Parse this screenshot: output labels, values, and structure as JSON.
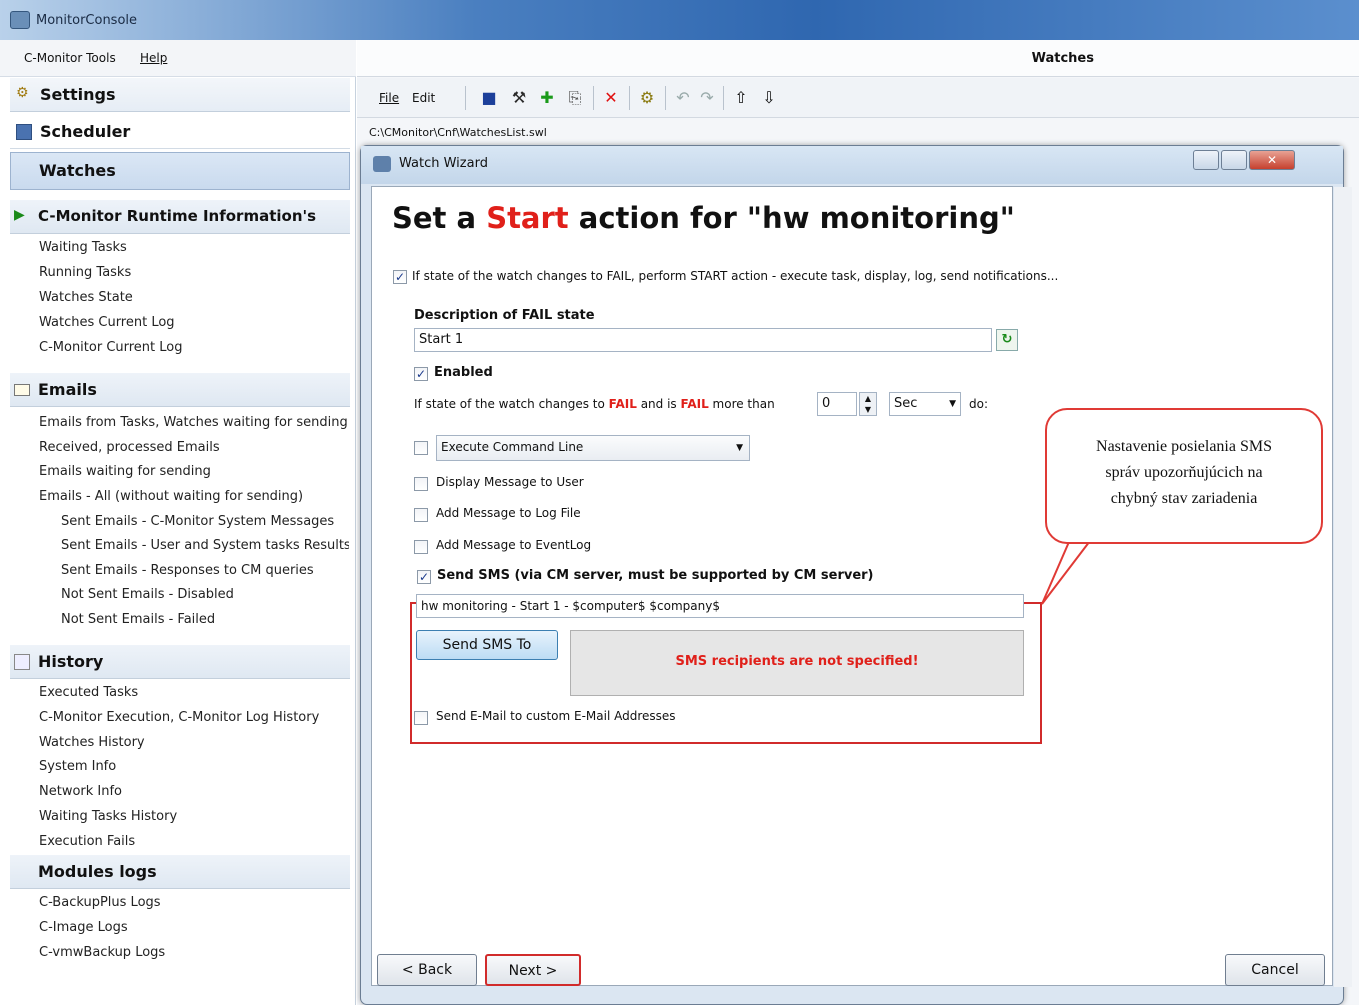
{
  "window": {
    "title": "MonitorConsole"
  },
  "menu": {
    "items": [
      "C-Monitor Tools",
      "Help"
    ]
  },
  "sidebar": {
    "settings": "Settings",
    "scheduler": "Scheduler",
    "watches": "Watches",
    "runtime": {
      "title": "C-Monitor Runtime Information's",
      "items": [
        "Waiting Tasks",
        "Running Tasks",
        "Watches State",
        "Watches Current Log",
        "C-Monitor Current Log"
      ]
    },
    "emails": {
      "title": "Emails",
      "items": [
        "Emails from Tasks, Watches waiting for sending",
        "Received, processed Emails",
        "Emails waiting for sending",
        "Emails - All (without waiting for sending)"
      ],
      "subitems": [
        "Sent Emails - C-Monitor System Messages",
        "Sent Emails - User and System tasks Results",
        "Sent Emails - Responses to CM queries",
        "Not Sent Emails - Disabled",
        "Not Sent Emails - Failed"
      ]
    },
    "history": {
      "title": "History",
      "items": [
        "Executed Tasks",
        "C-Monitor Execution, C-Monitor Log History",
        "Watches History",
        "System Info",
        "Network Info",
        "Waiting Tasks History",
        "Execution Fails"
      ]
    },
    "modules": {
      "title": "Modules logs",
      "items": [
        "C-BackupPlus Logs",
        "C-Image Logs",
        "C-vmwBackup Logs"
      ]
    }
  },
  "main": {
    "header": "Watches",
    "toolbar": {
      "file": "File",
      "edit": "Edit"
    },
    "path": "C:\\CMonitor\\Cnf\\WatchesList.swl"
  },
  "wizard": {
    "title": "Watch Wizard",
    "heading": {
      "prefix": "Set a ",
      "accent": "Start",
      "suffix": " action for \"hw monitoring\""
    },
    "perform_label": "If state of the watch changes to FAIL, perform START action - execute task, display, log, send notifications...",
    "desc_label": "Description of FAIL state",
    "desc_value": "Start 1",
    "enabled_label": "Enabled",
    "cond": {
      "p1": "If state of the watch changes to ",
      "fail1": "FAIL",
      "p2": " and is ",
      "fail2": "FAIL",
      "p3": " more than",
      "value": "0",
      "unit": "Sec",
      "p4": "do:"
    },
    "execute_select": "Execute Command Line",
    "options": [
      "Display Message to User",
      "Add Message to Log File",
      "Add Message to EventLog"
    ],
    "sms_label": "Send SMS (via CM server, must be supported by CM server)",
    "sms_text": "hw monitoring - Start 1 - $computer$ $company$",
    "sms_button": "Send SMS To",
    "sms_warning": "SMS recipients are not specified!",
    "email_label": "Send E-Mail to custom E-Mail Addresses",
    "back": "< Back",
    "next": "Next >",
    "cancel": "Cancel"
  },
  "callout": {
    "lines": [
      "Nastavenie posielania SMS",
      "správ upozorňujúcich na",
      "chybný stav zariadenia"
    ]
  }
}
